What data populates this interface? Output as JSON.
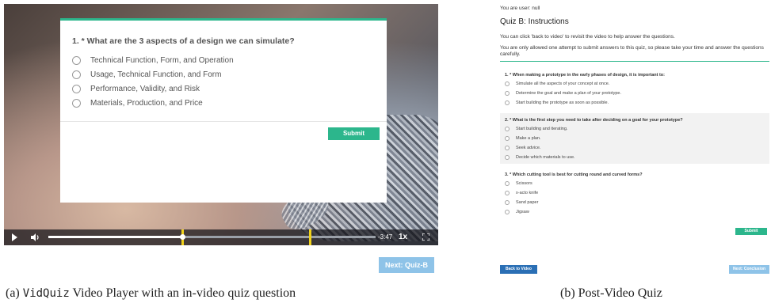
{
  "panel_a": {
    "question": "1. * What are the 3 aspects of a design we can simulate?",
    "options": [
      "Technical Function, Form, and Operation",
      "Usage, Technical Function, and Form",
      "Performance, Validity, and Risk",
      "Materials, Production, and Price"
    ],
    "submit_label": "Submit",
    "controls": {
      "time": "-3:47",
      "speed": "1x",
      "progress": 0.41,
      "quiz_markers": [
        0.41,
        0.8
      ]
    },
    "next_label": "Next: Quiz-B",
    "caption_prefix": "(a) ",
    "caption_app": "VidQuiz",
    "caption_rest": " Video Player with an in-video quiz question"
  },
  "panel_b": {
    "user_line": "You are user: null",
    "title": "Quiz B: Instructions",
    "instr1": "You can click 'back to video' to revisit the video to help answer the questions.",
    "instr2": "You are only allowed one attempt to submit answers to this quiz, so please take your time and answer the questions carefully.",
    "questions": [
      {
        "text": "1. * When making a prototype in the early phases of design, it is important to:",
        "options": [
          "Simulate all the aspects of your concept at once.",
          "Determine the goal and make a plan of your prototype.",
          "Start building the prototype as soon as possible."
        ]
      },
      {
        "text": "2. * What is the first step you need to take after deciding on a goal for your prototype?",
        "options": [
          "Start building and iterating.",
          "Make a plan.",
          "Seek advice.",
          "Decide which materials to use."
        ]
      },
      {
        "text": "3. * Which cutting tool is best for cutting round and curved forms?",
        "options": [
          "Scissors",
          "x-acto knife",
          "Sand paper",
          "Jigsaw"
        ]
      }
    ],
    "submit_label": "Submit",
    "back_label": "Back to Video",
    "next_label": "Next: Conclusion",
    "caption": "(b) Post-Video Quiz"
  },
  "colors": {
    "accent": "#2cb68c",
    "next_button": "#8ec3e8",
    "back_button": "#2a6fb5",
    "quiz_marker": "#f1d21a"
  },
  "icons": [
    "play-icon",
    "volume-icon",
    "fullscreen-icon"
  ]
}
